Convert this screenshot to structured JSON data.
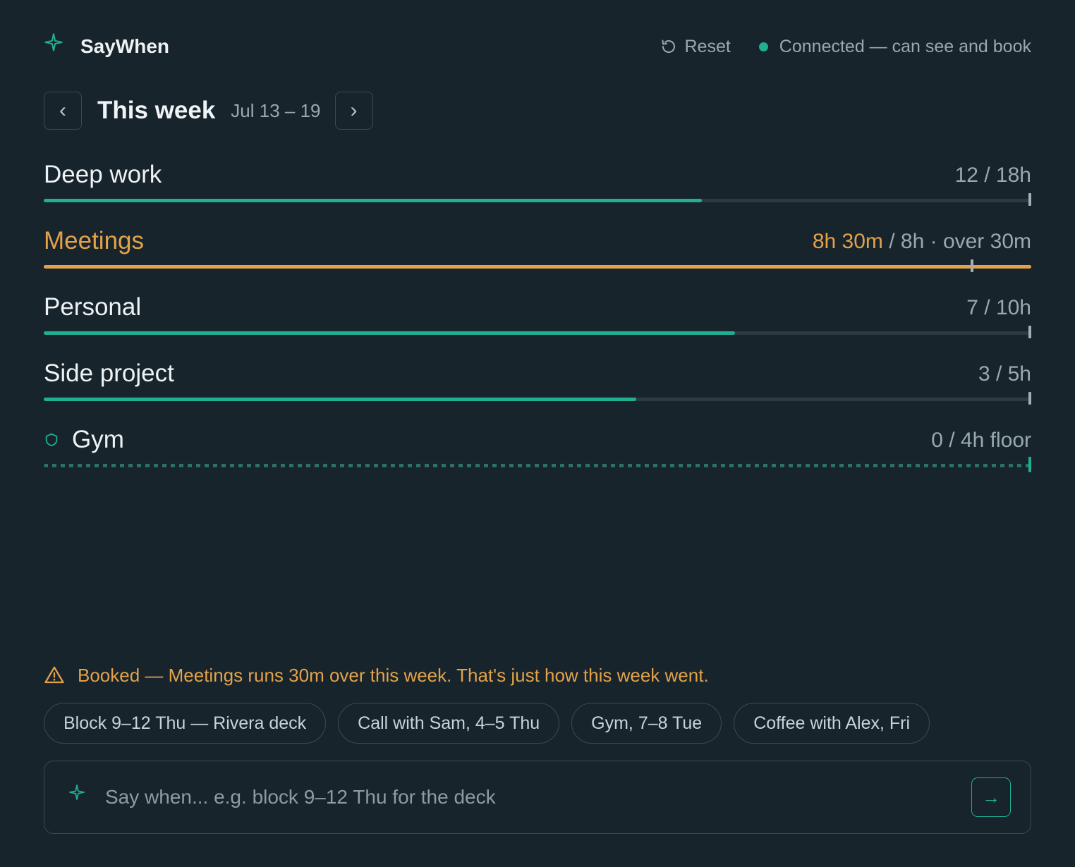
{
  "app": {
    "name": "SayWhen",
    "brand_icon": "sparkle-icon"
  },
  "header": {
    "reset_label": "Reset",
    "status_text": "Connected — can see and book",
    "status_color": "#1faf93"
  },
  "week": {
    "prev_label": "‹",
    "title": "This week",
    "range": "Jul 13 – 19",
    "next_label": "›"
  },
  "budgets": [
    {
      "label": "Deep work",
      "value_text": "12 / 18h",
      "used_hours": 12,
      "budget_hours": 18,
      "state": "normal"
    },
    {
      "label": "Meetings",
      "value_over": "8h 30m",
      "value_rest": " / 8h · over 30m",
      "used_hours": 8.5,
      "budget_hours": 8,
      "state": "over"
    },
    {
      "label": "Personal",
      "value_text": "7 / 10h",
      "used_hours": 7,
      "budget_hours": 10,
      "state": "normal"
    },
    {
      "label": "Side project",
      "value_text": "3 / 5h",
      "used_hours": 3,
      "budget_hours": 5,
      "state": "normal"
    },
    {
      "label": "Gym",
      "value_text": "0 / 4h floor",
      "used_hours": 0,
      "budget_hours": 4,
      "state": "floor",
      "icon": "shield-icon"
    }
  ],
  "colors": {
    "accent": "#1faf93",
    "warning": "#e3a24a",
    "background": "#17242b"
  },
  "alert": {
    "icon": "warning-icon",
    "text": "Booked — Meetings runs 30m over this week. That's just how this week went."
  },
  "suggestions": [
    "Block 9–12 Thu — Rivera deck",
    "Call with Sam, 4–5 Thu",
    "Gym, 7–8 Tue",
    "Coffee with Alex, Fri"
  ],
  "prompt": {
    "placeholder": "Say when... e.g. block 9–12 Thu for the deck",
    "value": "",
    "send_label": "→"
  }
}
